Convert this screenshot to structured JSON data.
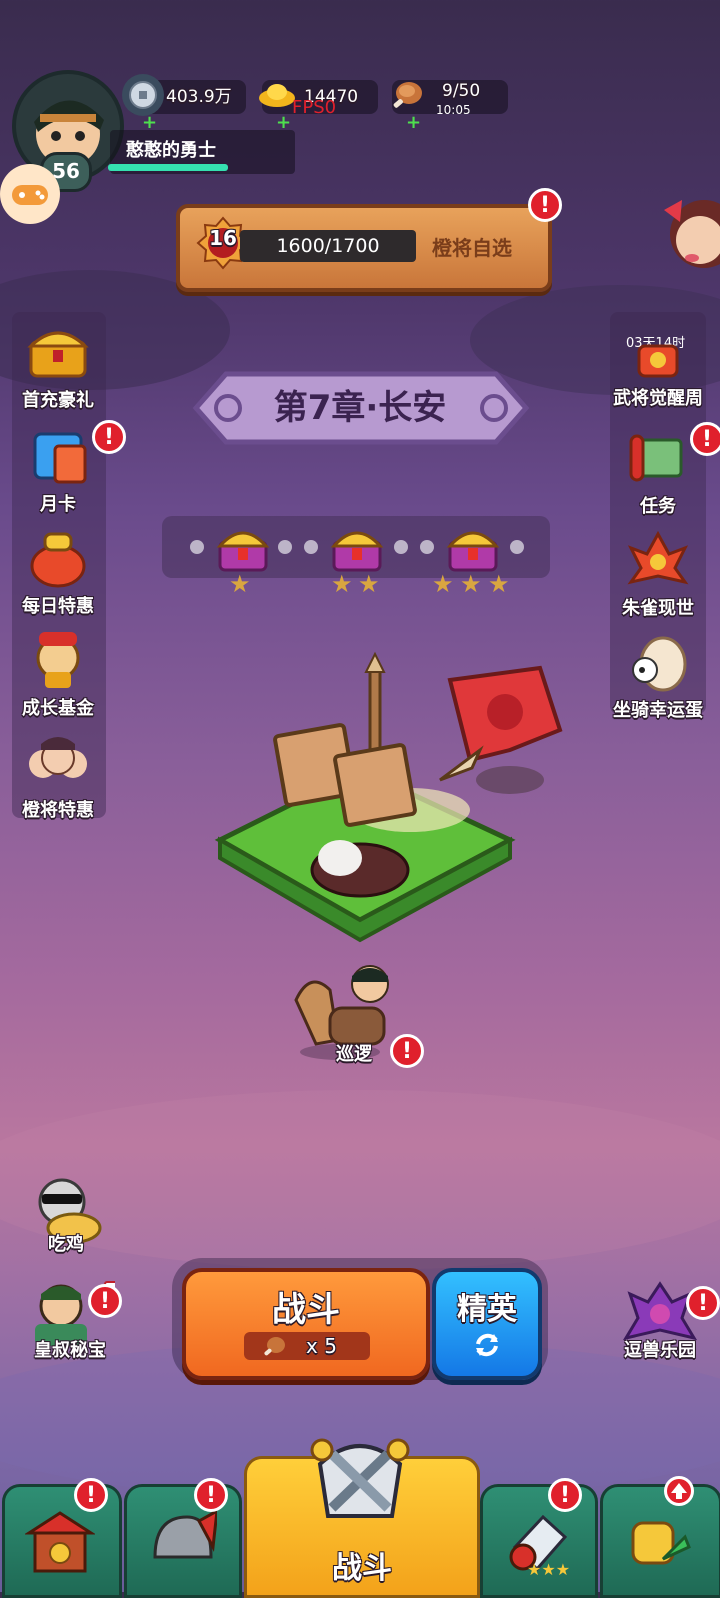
{
  "player": {
    "level": "56",
    "name": "憨憨的勇士"
  },
  "resources": {
    "silver": "403.9万",
    "gold": "14470",
    "fps": "FPS0",
    "stamina": "9/50",
    "stamina_timer": "10:05"
  },
  "banner": {
    "rank": "16",
    "progress": "1600/1700",
    "label": "橙将自选"
  },
  "chapter": {
    "title": "第7章·长安"
  },
  "left_menu": [
    "首充豪礼",
    "月卡",
    "每日特惠",
    "成长基金",
    "橙将特惠"
  ],
  "right_menu": {
    "timer": "03天14时",
    "items": [
      "武将觉醒周",
      "任务",
      "朱雀现世",
      "坐骑幸运蛋"
    ]
  },
  "patrol": {
    "label": "巡逻"
  },
  "bottom_left": [
    "吃鸡",
    "皇叔秘宝"
  ],
  "bottom_right": [
    "逗兽乐园"
  ],
  "fight": {
    "label": "战斗",
    "cost": "x 5"
  },
  "elite": {
    "label": "精英"
  },
  "nav": {
    "center_label": "战斗"
  },
  "badge_mark": "!",
  "colors": {
    "alert": "#e0202c",
    "fight": "#f06820",
    "elite": "#1478e6"
  }
}
